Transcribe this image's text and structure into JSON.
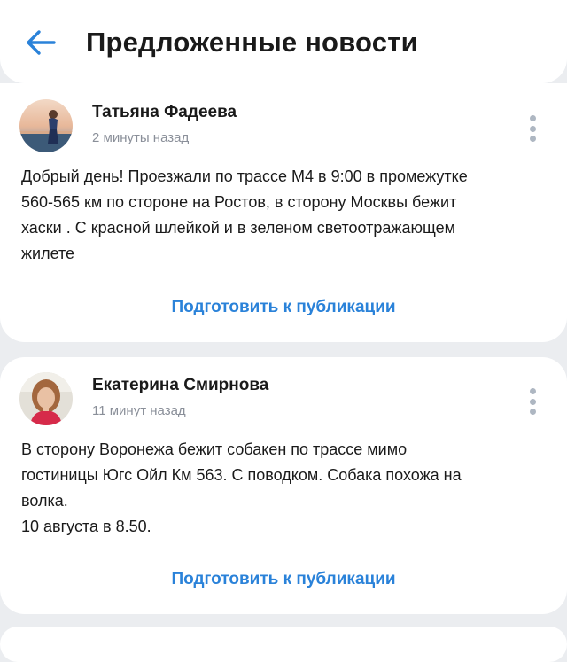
{
  "header": {
    "back_icon": "arrow-left-icon",
    "title": "Предложенные новости",
    "accent_color": "#2a82d9"
  },
  "posts": [
    {
      "author": "Татьяна Фадеева",
      "time": "2 минуты назад",
      "text_lines": [
        "Добрый день! Проезжали по трассе М4 в 9:00 в промежутке",
        "560-565 км по стороне на Ростов, в сторону Москвы бежит",
        "хаски . С красной шлейкой и в зеленом светоотражающем",
        "жилете"
      ],
      "action": "Подготовить к публикации"
    },
    {
      "author": "Екатерина Смирнова",
      "time": "11 минут назад",
      "text_lines": [
        "В сторону Воронежа бежит собакен по трассе мимо",
        "гостиницы Югс Ойл Км 563. С поводком. Собака похожа на",
        "волка.",
        "10 августа в 8.50."
      ],
      "action": "Подготовить к публикации"
    }
  ]
}
